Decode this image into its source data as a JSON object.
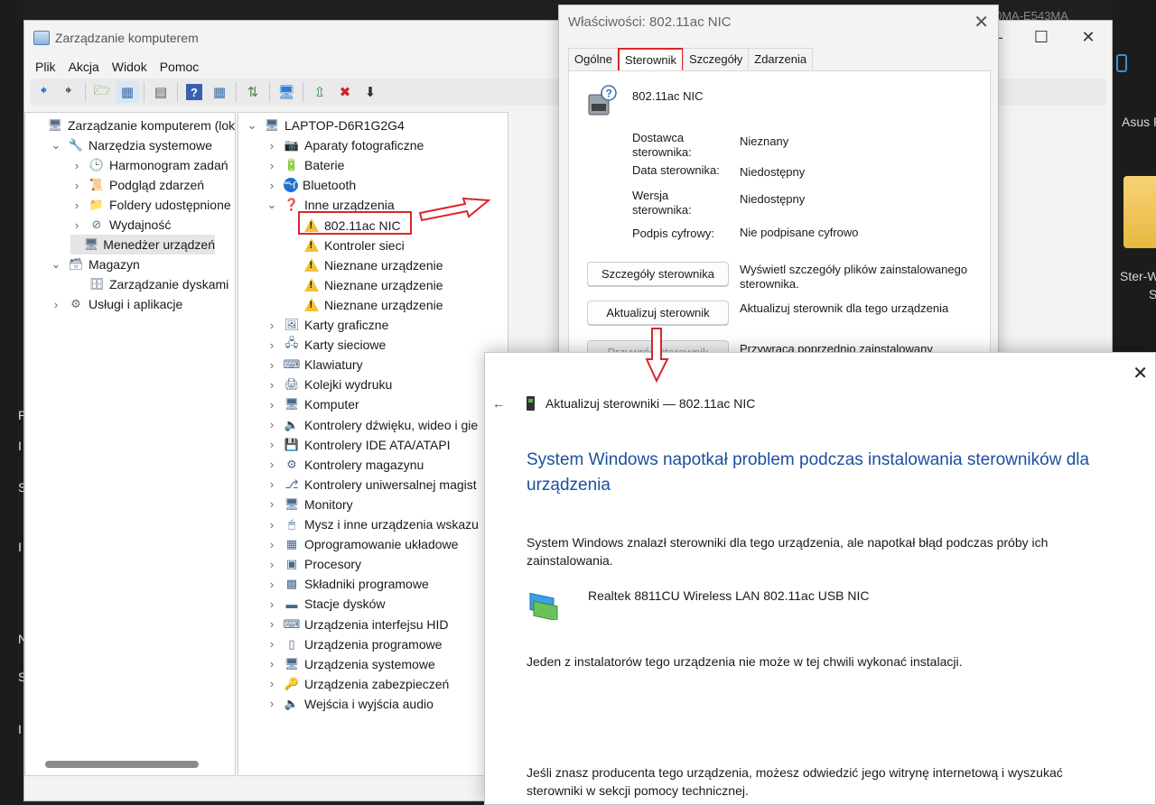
{
  "main": {
    "title": "Zarządzanie komputerem",
    "menu": [
      "Plik",
      "Akcja",
      "Widok",
      "Pomoc"
    ],
    "left_tree": [
      {
        "label": "Zarządzanie komputerem (lokal",
        "level": 0,
        "arrow": ""
      },
      {
        "label": "Narzędzia systemowe",
        "level": 1,
        "arrow": "v"
      },
      {
        "label": "Harmonogram zadań",
        "level": 2,
        "arrow": ">"
      },
      {
        "label": "Podgląd zdarzeń",
        "level": 2,
        "arrow": ">"
      },
      {
        "label": "Foldery udostępnione",
        "level": 2,
        "arrow": ">"
      },
      {
        "label": "Wydajność",
        "level": 2,
        "arrow": ">"
      },
      {
        "label": "Menedżer urządzeń",
        "level": 2,
        "arrow": ""
      },
      {
        "label": "Magazyn",
        "level": 1,
        "arrow": "v"
      },
      {
        "label": "Zarządzanie dyskami",
        "level": 2,
        "arrow": ""
      },
      {
        "label": "Usługi i aplikacje",
        "level": 1,
        "arrow": ">"
      }
    ],
    "device_tree": [
      {
        "label": "LAPTOP-D6R1G2G4",
        "level": 0,
        "arrow": "v",
        "icon": "computer-icon"
      },
      {
        "label": "Aparaty fotograficzne",
        "level": 1,
        "arrow": ">",
        "icon": "camera-icon"
      },
      {
        "label": "Baterie",
        "level": 1,
        "arrow": ">",
        "icon": "battery-icon"
      },
      {
        "label": "Bluetooth",
        "level": 1,
        "arrow": ">",
        "icon": "bluetooth-icon"
      },
      {
        "label": "Inne urządzenia",
        "level": 1,
        "arrow": "v",
        "icon": "unknown-device-icon"
      },
      {
        "label": "802.11ac NIC",
        "level": 2,
        "arrow": "",
        "icon": "warning-icon"
      },
      {
        "label": "Kontroler sieci",
        "level": 2,
        "arrow": "",
        "icon": "warning-icon"
      },
      {
        "label": "Nieznane urządzenie",
        "level": 2,
        "arrow": "",
        "icon": "warning-icon"
      },
      {
        "label": "Nieznane urządzenie",
        "level": 2,
        "arrow": "",
        "icon": "warning-icon"
      },
      {
        "label": "Nieznane urządzenie",
        "level": 2,
        "arrow": "",
        "icon": "warning-icon"
      },
      {
        "label": "Karty graficzne",
        "level": 1,
        "arrow": ">",
        "icon": "display-adapter-icon"
      },
      {
        "label": "Karty sieciowe",
        "level": 1,
        "arrow": ">",
        "icon": "network-adapter-icon"
      },
      {
        "label": "Klawiatury",
        "level": 1,
        "arrow": ">",
        "icon": "keyboard-icon"
      },
      {
        "label": "Kolejki wydruku",
        "level": 1,
        "arrow": ">",
        "icon": "printer-icon"
      },
      {
        "label": "Komputer",
        "level": 1,
        "arrow": ">",
        "icon": "monitor-icon"
      },
      {
        "label": "Kontrolery dźwięku, wideo i gie",
        "level": 1,
        "arrow": ">",
        "icon": "speaker-icon"
      },
      {
        "label": "Kontrolery IDE ATA/ATAPI",
        "level": 1,
        "arrow": ">",
        "icon": "ide-icon"
      },
      {
        "label": "Kontrolery magazynu",
        "level": 1,
        "arrow": ">",
        "icon": "storage-icon"
      },
      {
        "label": "Kontrolery uniwersalnej magist",
        "level": 1,
        "arrow": ">",
        "icon": "usb-icon"
      },
      {
        "label": "Monitory",
        "level": 1,
        "arrow": ">",
        "icon": "monitor-icon"
      },
      {
        "label": "Mysz i inne urządzenia wskazu",
        "level": 1,
        "arrow": ">",
        "icon": "mouse-icon"
      },
      {
        "label": "Oprogramowanie układowe",
        "level": 1,
        "arrow": ">",
        "icon": "firmware-icon"
      },
      {
        "label": "Procesory",
        "level": 1,
        "arrow": ">",
        "icon": "processor-icon"
      },
      {
        "label": "Składniki programowe",
        "level": 1,
        "arrow": ">",
        "icon": "software-component-icon"
      },
      {
        "label": "Stacje dysków",
        "level": 1,
        "arrow": ">",
        "icon": "disk-drive-icon"
      },
      {
        "label": "Urządzenia interfejsu HID",
        "level": 1,
        "arrow": ">",
        "icon": "hid-icon"
      },
      {
        "label": "Urządzenia programowe",
        "level": 1,
        "arrow": ">",
        "icon": "software-device-icon"
      },
      {
        "label": "Urządzenia systemowe",
        "level": 1,
        "arrow": ">",
        "icon": "system-device-icon"
      },
      {
        "label": "Urządzenia zabezpieczeń",
        "level": 1,
        "arrow": ">",
        "icon": "security-device-icon"
      },
      {
        "label": "Wejścia i wyjścia audio",
        "level": 1,
        "arrow": ">",
        "icon": "audio-icon"
      }
    ]
  },
  "background": {
    "top_right_text": "0MA-E543MA",
    "side_label": "Asus F",
    "folder_label_1": "Ster-W",
    "folder_label_2": "S",
    "left_letters": [
      "P",
      "I",
      "S",
      "I",
      "N",
      "S",
      "I"
    ]
  },
  "properties": {
    "title": "Właściwości: 802.11ac NIC",
    "tabs": [
      "Ogólne",
      "Sterownik",
      "Szczegóły",
      "Zdarzenia"
    ],
    "active_tab": "Sterownik",
    "device_name": "802.11ac NIC",
    "rows": [
      {
        "label": "Dostawca sterownika:",
        "value": "Nieznany"
      },
      {
        "label": "Data sterownika:",
        "value": "Niedostępny"
      },
      {
        "label": "Wersja sterownika:",
        "value": "Niedostępny"
      },
      {
        "label": "Podpis cyfrowy:",
        "value": "Nie podpisane cyfrowo"
      }
    ],
    "buttons": [
      {
        "label": "Szczegóły sterownika",
        "desc": "Wyświetl szczegóły plików zainstalowanego sterownika."
      },
      {
        "label": "Aktualizuj sterownik",
        "desc": "Aktualizuj sterownik dla tego urządzenia"
      },
      {
        "label": "Przywróć sterownik",
        "desc": "Przywraca poprzednio zainstalowany"
      }
    ]
  },
  "update": {
    "header": "Aktualizuj sterowniki — 802.11ac NIC",
    "heading": "System Windows napotkał problem podczas instalowania sterowników dla urządzenia",
    "p1": "System Windows znalazł sterowniki dla tego urządzenia, ale napotkał błąd podczas próby ich zainstalowania.",
    "device": "Realtek 8811CU Wireless LAN 802.11ac USB NIC",
    "p2": "Jeden z instalatorów tego urządzenia nie może w tej chwili wykonać instalacji.",
    "p3": "Jeśli znasz producenta tego urządzenia, możesz odwiedzić jego witrynę internetową i wyszukać sterowniki w sekcji pomocy technicznej."
  },
  "colors": {
    "accent": "#1c4fa0",
    "highlight": "#d9262b",
    "warning": "#f1c232"
  }
}
